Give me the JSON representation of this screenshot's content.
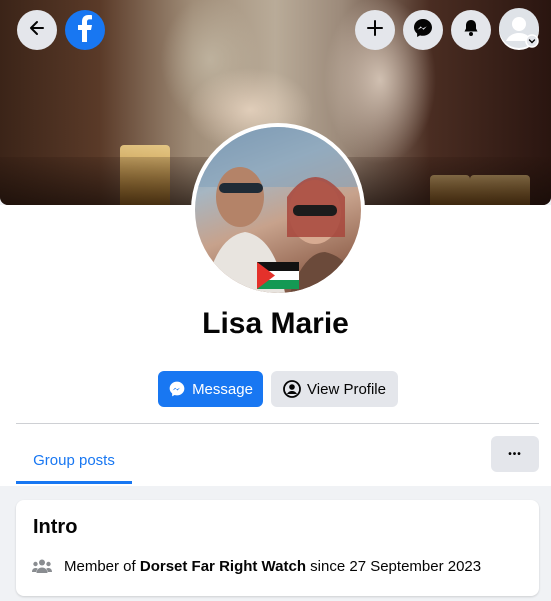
{
  "header": {
    "back_icon": "back-arrow-icon",
    "logo_icon": "facebook-logo-icon",
    "create_icon": "plus-icon",
    "messenger_icon": "messenger-icon",
    "notifications_icon": "bell-icon",
    "account_icon": "account-avatar-icon"
  },
  "profile": {
    "name": "Lisa Marie"
  },
  "actions": {
    "message_label": "Message",
    "view_profile_label": "View Profile"
  },
  "tabs": {
    "group_posts_label": "Group posts",
    "more_label": "•••"
  },
  "intro": {
    "title": "Intro",
    "member_prefix": "Member of",
    "group_name": "Dorset Far Right Watch",
    "member_suffix": "since 27 September 2023"
  },
  "colors": {
    "accent": "#1877f2",
    "background": "#f0f2f5",
    "button_secondary": "#e4e6eb"
  }
}
